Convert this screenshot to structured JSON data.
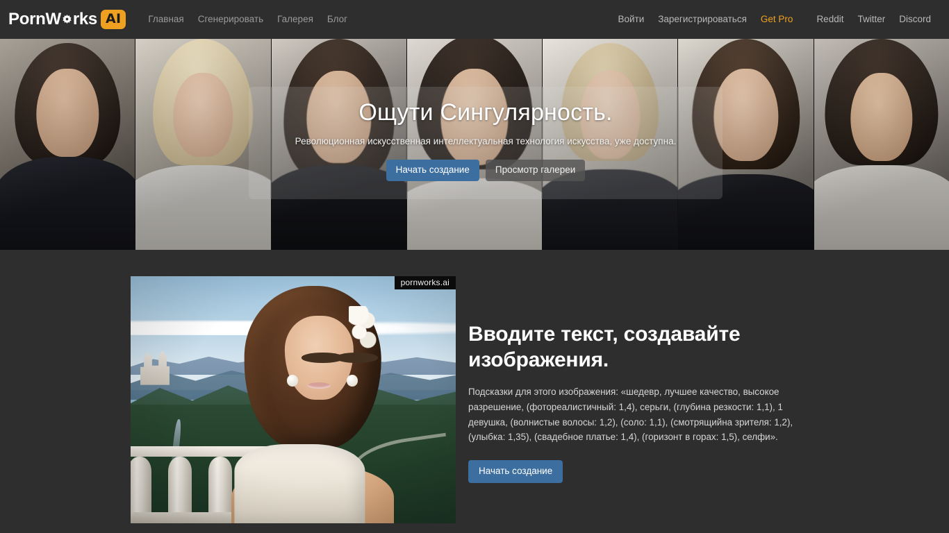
{
  "brand": {
    "text_before": "PornW",
    "gear_icon": "gear-icon",
    "text_after": "rks",
    "badge": "AI"
  },
  "navbar": {
    "left_links": [
      {
        "label": "Главная",
        "name": "nav-link-home"
      },
      {
        "label": "Сгенерировать",
        "name": "nav-link-generate"
      },
      {
        "label": "Галерея",
        "name": "nav-link-gallery"
      },
      {
        "label": "Блог",
        "name": "nav-link-blog"
      }
    ],
    "right_links": [
      {
        "label": "Войти",
        "name": "nav-link-login"
      },
      {
        "label": "Зарегистрироваться",
        "name": "nav-link-register"
      },
      {
        "label": "Get Pro",
        "name": "nav-link-get-pro",
        "accent": true
      },
      {
        "label": "Reddit",
        "name": "nav-link-reddit"
      },
      {
        "label": "Twitter",
        "name": "nav-link-twitter"
      },
      {
        "label": "Discord",
        "name": "nav-link-discord"
      }
    ]
  },
  "hero": {
    "title": "Ощути Сингулярность.",
    "subtitle": "Революционная искусственная интеллектуальная технология искусства, уже доступна.",
    "primary_button": "Начать создание",
    "secondary_button": "Просмотр галереи"
  },
  "feature": {
    "watermark": "pornworks.ai",
    "heading": "Вводите текст, создавайте изображения.",
    "paragraph": "Подсказки для этого изображения: «шедевр, лучшее качество, высокое разрешение, (фотореалистичный: 1,4), серьги, (глубина резкости: 1,1), 1 девушка, (волнистые волосы: 1,2), (соло: 1,1), (смотрящийна зрителя: 1,2), (улыбка: 1,35), (свадебное платье: 1,4), (горизонт в горах: 1,5), селфи».",
    "button": "Начать создание"
  },
  "colors": {
    "page_background": "#2e2e2e",
    "navbar_background": "#2e2e2e",
    "accent": "#f0a020",
    "primary_button": "#3c6e9f",
    "secondary_button": "#555555",
    "nav_link": "#9a9a9a",
    "body_text": "#d6d6d6",
    "heading_text": "#ffffff"
  }
}
